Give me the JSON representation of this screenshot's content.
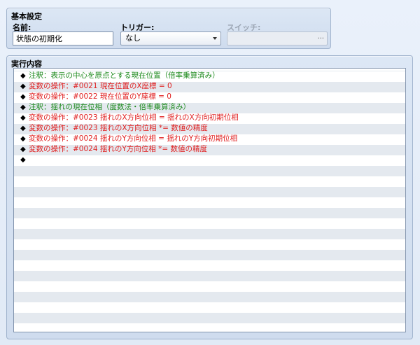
{
  "basic": {
    "title": "基本設定",
    "name_label": "名前:",
    "name_value": "状態の初期化",
    "trigger_label": "トリガー:",
    "trigger_value": "なし",
    "switch_label": "スイッチ:",
    "switch_button": "..."
  },
  "exec": {
    "title": "実行内容",
    "rows": [
      {
        "marker": "◆",
        "text": "注釈：表示の中心を原点とする現在位置（倍率乗算済み）",
        "color": "green"
      },
      {
        "marker": "◆",
        "text": "変数の操作：#0021 現在位置のX座標 = 0",
        "color": "red"
      },
      {
        "marker": "◆",
        "text": "変数の操作：#0022 現在位置のY座標 = 0",
        "color": "red"
      },
      {
        "marker": "◆",
        "text": "注釈：揺れの現在位相（度数法・倍率乗算済み）",
        "color": "green"
      },
      {
        "marker": "◆",
        "text": "変数の操作：#0023 揺れのX方向位相 = 揺れのX方向初期位相",
        "color": "red"
      },
      {
        "marker": "◆",
        "text": "変数の操作：#0023 揺れのX方向位相 *= 数値の精度",
        "color": "red"
      },
      {
        "marker": "◆",
        "text": "変数の操作：#0024 揺れのY方向位相 = 揺れのY方向初期位相",
        "color": "red"
      },
      {
        "marker": "◆",
        "text": "変数の操作：#0024 揺れのY方向位相 *= 数値の精度",
        "color": "red"
      },
      {
        "marker": "◆",
        "text": "",
        "color": "black"
      }
    ]
  }
}
